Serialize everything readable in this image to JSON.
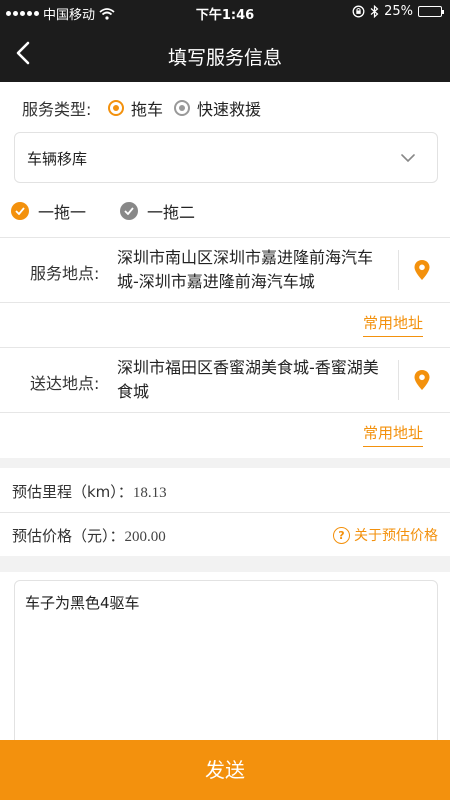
{
  "status_bar": {
    "carrier": "中国移动",
    "time": "下午1:46",
    "battery": "25%",
    "battery_level": 0.25
  },
  "nav": {
    "title": "填写服务信息",
    "back_icon": "chevron-left-icon"
  },
  "service_type": {
    "label": "服务类型:",
    "options": [
      "拖车",
      "快速救援"
    ],
    "selected": "拖车"
  },
  "vehicle_select": {
    "value": "车辆移库"
  },
  "tow_mode": {
    "options": [
      "一拖一",
      "一拖二"
    ],
    "selected": "一拖一"
  },
  "service_location": {
    "label": "服务地点:",
    "address": "深圳市南山区深圳市嘉进隆前海汽车城-深圳市嘉进隆前海汽车城",
    "common_link": "常用地址"
  },
  "delivery_location": {
    "label": "送达地点:",
    "address": "深圳市福田区香蜜湖美食城-香蜜湖美食城",
    "common_link": "常用地址"
  },
  "estimate": {
    "mileage_label": "预估里程（km）：",
    "mileage_value": "18.13",
    "price_label": "预估价格（元）：",
    "price_value": "200.00",
    "about_price": "关于预估价格"
  },
  "note": {
    "text": "车子为黑色4驱车"
  },
  "submit": {
    "label": "发送"
  },
  "colors": {
    "accent": "#f3910d",
    "header": "#1c1c1c"
  }
}
